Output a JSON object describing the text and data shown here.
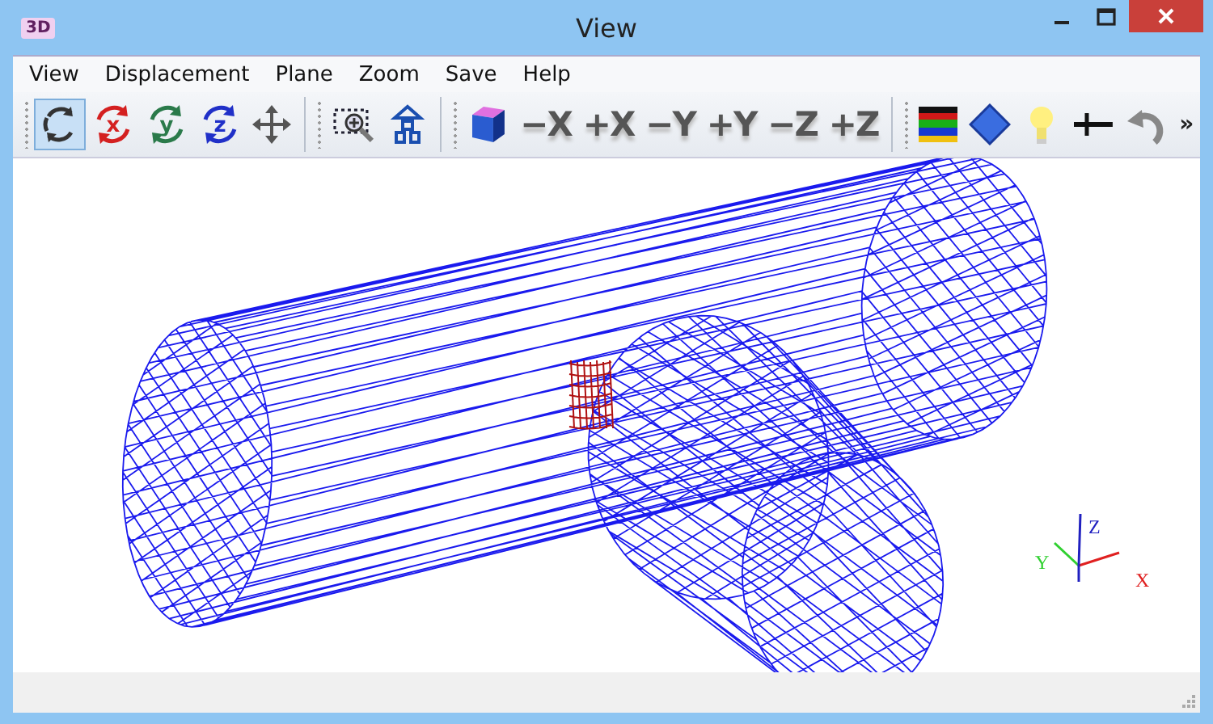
{
  "window": {
    "title": "View",
    "app_icon": "3D"
  },
  "menu": [
    "View",
    "Displacement",
    "Plane",
    "Zoom",
    "Save",
    "Help"
  ],
  "toolbar": [
    {
      "kind": "rotate",
      "selected": true
    },
    {
      "kind": "rotate-axis",
      "label": "x",
      "color": "#d42020",
      "selected": false
    },
    {
      "kind": "rotate-axis",
      "label": "y",
      "color": "#2a7a4a",
      "selected": false
    },
    {
      "kind": "rotate-axis",
      "label": "z",
      "color": "#2030c8",
      "selected": false
    },
    {
      "kind": "pan",
      "selected": false
    },
    {
      "kind": "separator"
    },
    {
      "kind": "zoom-box",
      "selected": false
    },
    {
      "kind": "fit",
      "selected": false
    },
    {
      "kind": "separator"
    },
    {
      "kind": "cube",
      "selected": false
    },
    {
      "kind": "text",
      "label": "−X",
      "selected": false
    },
    {
      "kind": "text",
      "label": "+X",
      "selected": false
    },
    {
      "kind": "text",
      "label": "−Y",
      "selected": false
    },
    {
      "kind": "text",
      "label": "+Y",
      "selected": false
    },
    {
      "kind": "text",
      "label": "−Z",
      "selected": false
    },
    {
      "kind": "text",
      "label": "+Z",
      "selected": false
    },
    {
      "kind": "separator"
    },
    {
      "kind": "color-bands",
      "selected": false
    },
    {
      "kind": "diamond",
      "selected": false
    },
    {
      "kind": "bulb",
      "selected": false
    },
    {
      "kind": "line",
      "selected": false
    },
    {
      "kind": "undo",
      "selected": false
    },
    {
      "kind": "overflow",
      "label": "»",
      "selected": false
    }
  ],
  "viewport": {
    "axes": [
      {
        "label": "X",
        "color": "#e02020"
      },
      {
        "label": "Y",
        "color": "#30d030"
      },
      {
        "label": "Z",
        "color": "#2020c0"
      }
    ]
  }
}
